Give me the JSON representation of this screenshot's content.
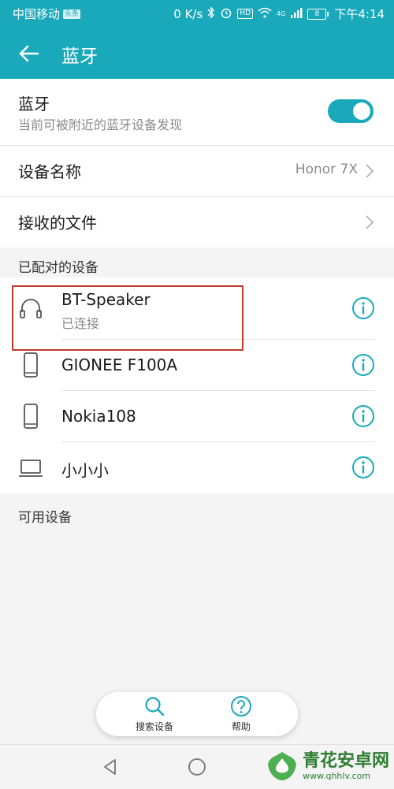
{
  "status_bar": {
    "carrier": "中国移动",
    "carrier_badge": "头条",
    "speed": "0 K/s",
    "hd": "HD",
    "network": "4G",
    "battery": "8",
    "time": "下午4:14"
  },
  "app_bar": {
    "title": "蓝牙"
  },
  "bluetooth": {
    "title": "蓝牙",
    "subtitle": "当前可被附近的蓝牙设备发现",
    "enabled": true
  },
  "device_name": {
    "label": "设备名称",
    "value": "Honor 7X"
  },
  "received_files": {
    "label": "接收的文件"
  },
  "paired_section": {
    "header": "已配对的设备",
    "devices": [
      {
        "name": "BT-Speaker",
        "status": "已连接",
        "icon": "headphones-icon"
      },
      {
        "name": "GIONEE F100A",
        "status": "",
        "icon": "phone-icon"
      },
      {
        "name": "Nokia108",
        "status": "",
        "icon": "phone-icon"
      },
      {
        "name": "小小小",
        "status": "",
        "icon": "laptop-icon"
      }
    ]
  },
  "available_section": {
    "header": "可用设备"
  },
  "bottom_actions": {
    "search_label": "搜索设备",
    "help_label": "帮助"
  },
  "watermark": {
    "title": "青花安卓网",
    "url": "www.qhhlv.com"
  },
  "colors": {
    "accent": "#19a9bb",
    "highlight_border": "#c0392b"
  }
}
